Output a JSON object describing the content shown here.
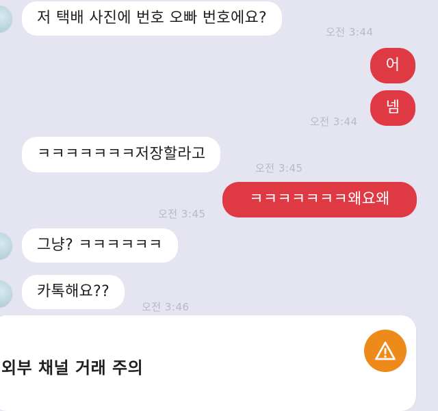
{
  "messages": [
    {
      "text": "저 택배 사진에 번호 오빠 번호에요?",
      "time": "오전 3:44"
    },
    {
      "text": "어"
    },
    {
      "text": "넴",
      "time": "오전 3:44"
    },
    {
      "text": "ㅋㅋㅋㅋㅋㅋㅋ저장할라고",
      "time": "오전 3:45"
    },
    {
      "text": "ㅋㅋㅋㅋㅋㅋㅋ왜요왜",
      "time": "오전 3:45"
    },
    {
      "text": "그냥? ㅋㅋㅋㅋㅋㅋ"
    },
    {
      "text": "카톡해요??",
      "time": "오전 3:46"
    }
  ],
  "notice": {
    "title": "외부 채널 거래 주의",
    "icon": "warning-icon",
    "icon_color": "#ee8a1a"
  },
  "colors": {
    "outgoing_bubble": "#df3a44",
    "incoming_bubble": "#ffffff",
    "background": "#e5e5f1"
  }
}
